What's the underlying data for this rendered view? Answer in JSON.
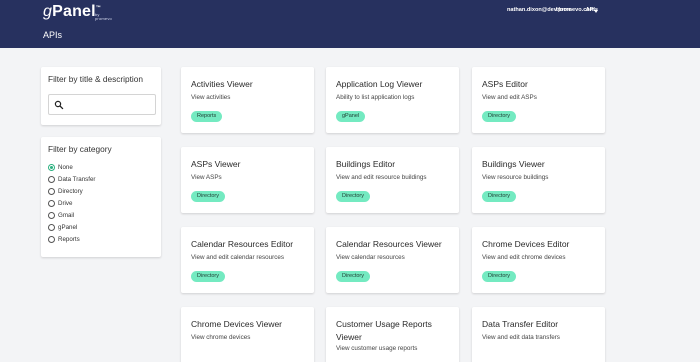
{
  "header": {
    "logo_g": "g",
    "logo_rest": "Panel",
    "logo_tm": "™",
    "logo_by": "by promevo",
    "nav": [
      "Home",
      "APIs"
    ],
    "user": "nathan.dixon@dev.promevo.com",
    "page_title": "APIs",
    "bg_color": "#27315f"
  },
  "filters": {
    "title_filter": {
      "title": "Filter by title & description",
      "search_value": "",
      "search_icon": "search-icon"
    },
    "category_filter": {
      "title": "Filter by category",
      "selected": "None",
      "options": [
        "None",
        "Data Transfer",
        "Directory",
        "Drive",
        "Gmail",
        "gPanel",
        "Reports"
      ]
    }
  },
  "badge_color": "#74eac1",
  "cards": [
    {
      "title": "Activities Viewer",
      "description": "View activities",
      "category": "Reports"
    },
    {
      "title": "Application Log Viewer",
      "description": "Ability to list application logs",
      "category": "gPanel"
    },
    {
      "title": "ASPs Editor",
      "description": "View and edit ASPs",
      "category": "Directory"
    },
    {
      "title": "ASPs Viewer",
      "description": "View ASPs",
      "category": "Directory"
    },
    {
      "title": "Buildings Editor",
      "description": "View and edit resource buildings",
      "category": "Directory"
    },
    {
      "title": "Buildings Viewer",
      "description": "View resource buildings",
      "category": "Directory"
    },
    {
      "title": "Calendar Resources Editor",
      "description": "View and edit calendar resources",
      "category": "Directory"
    },
    {
      "title": "Calendar Resources Viewer",
      "description": "View calendar resources",
      "category": "Directory"
    },
    {
      "title": "Chrome Devices Editor",
      "description": "View and edit chrome devices",
      "category": "Directory"
    },
    {
      "title": "Chrome Devices Viewer",
      "description": "View chrome devices",
      "category": ""
    },
    {
      "title": "Customer Usage Reports Viewer",
      "description": "View customer usage reports",
      "category": ""
    },
    {
      "title": "Data Transfer Editor",
      "description": "View and edit data transfers",
      "category": ""
    }
  ]
}
